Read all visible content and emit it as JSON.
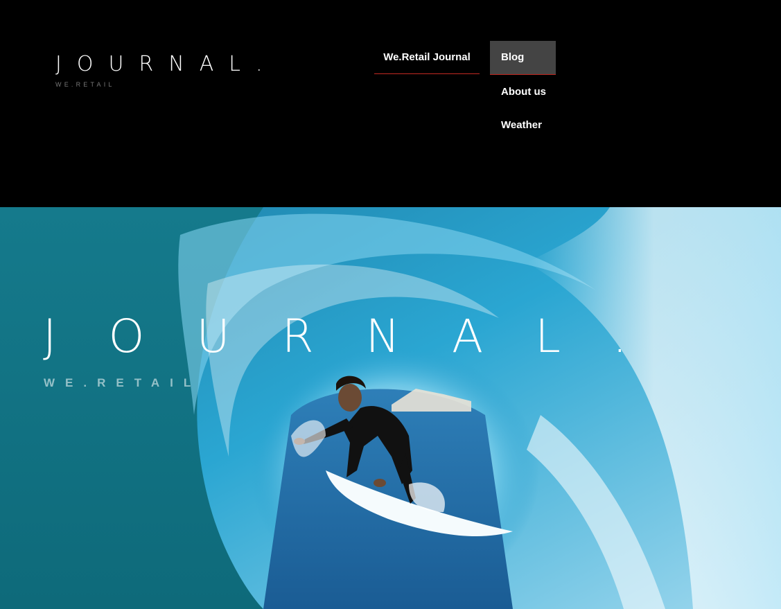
{
  "header": {
    "logo_title": "JOURNAL.",
    "logo_subtitle": "WE.RETAIL"
  },
  "nav": {
    "primary_label": "We.Retail Journal",
    "items": [
      {
        "label": "Blog",
        "active": true
      },
      {
        "label": "About us"
      },
      {
        "label": "Weather"
      }
    ]
  },
  "hero": {
    "title": "JOURNAL.",
    "subtitle": "WE.RETAIL",
    "image": "surfer-in-wave-photo"
  },
  "colors": {
    "background": "#000000",
    "active_item_bg": "#444444",
    "accent_underline": "#c42a22",
    "text": "#ffffff",
    "hero_water": "#2a9fc8"
  }
}
